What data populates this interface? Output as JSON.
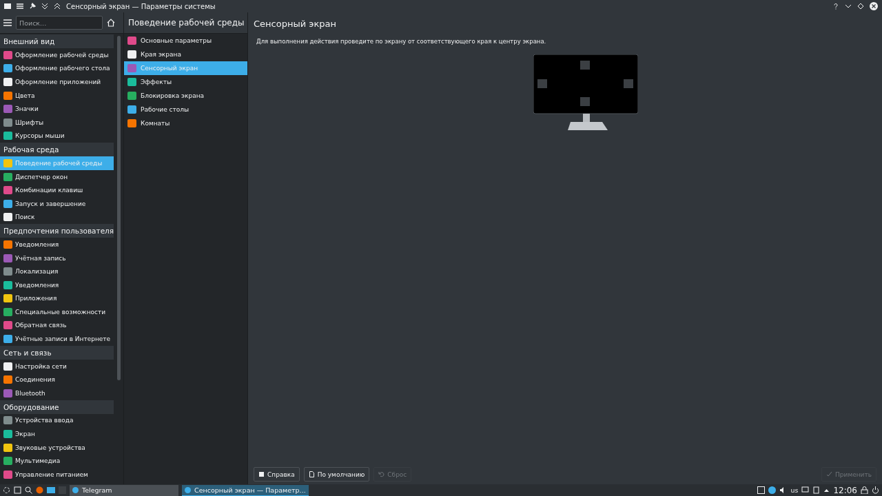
{
  "window": {
    "title": "Сенсорный экран — Параметры системы"
  },
  "sidebar": {
    "search": {
      "placeholder": "Поиск..."
    },
    "sections": [
      {
        "title": "Внешний вид",
        "items": [
          {
            "label": "Оформление рабочей среды",
            "selected": false
          },
          {
            "label": "Оформление рабочего стола",
            "selected": false
          },
          {
            "label": "Оформление приложений",
            "selected": false
          },
          {
            "label": "Цвета",
            "selected": false
          },
          {
            "label": "Значки",
            "selected": false
          },
          {
            "label": "Шрифты",
            "selected": false
          },
          {
            "label": "Курсоры мыши",
            "selected": false
          }
        ]
      },
      {
        "title": "Рабочая среда",
        "items": [
          {
            "label": "Поведение рабочей среды",
            "selected": true
          },
          {
            "label": "Диспетчер окон",
            "selected": false
          },
          {
            "label": "Комбинации клавиш",
            "selected": false
          },
          {
            "label": "Запуск и завершение",
            "selected": false
          },
          {
            "label": "Поиск",
            "selected": false
          }
        ]
      },
      {
        "title": "Предпочтения пользователя",
        "items": [
          {
            "label": "Уведомления",
            "selected": false
          },
          {
            "label": "Учётная запись",
            "selected": false
          },
          {
            "label": "Локализация",
            "selected": false
          },
          {
            "label": "Уведомления",
            "selected": false
          },
          {
            "label": "Приложения",
            "selected": false
          },
          {
            "label": "Специальные возможности",
            "selected": false
          },
          {
            "label": "Обратная связь",
            "selected": false
          },
          {
            "label": "Учётные записи в Интернете",
            "selected": false
          }
        ]
      },
      {
        "title": "Сеть и связь",
        "items": [
          {
            "label": "Настройка сети",
            "selected": false
          },
          {
            "label": "Соединения",
            "selected": false
          },
          {
            "label": "Bluetooth",
            "selected": false
          }
        ]
      },
      {
        "title": "Оборудование",
        "items": [
          {
            "label": "Устройства ввода",
            "selected": false
          },
          {
            "label": "Экран",
            "selected": false
          },
          {
            "label": "Звуковые устройства",
            "selected": false
          },
          {
            "label": "Мультимедиа",
            "selected": false
          },
          {
            "label": "Управление питанием",
            "selected": false
          }
        ]
      }
    ]
  },
  "subpanel": {
    "title": "Поведение рабочей среды",
    "items": [
      {
        "label": "Основные параметры",
        "selected": false
      },
      {
        "label": "Края экрана",
        "selected": false
      },
      {
        "label": "Сенсорный экран",
        "selected": true
      },
      {
        "label": "Эффекты",
        "selected": false
      },
      {
        "label": "Блокировка экрана",
        "selected": false
      },
      {
        "label": "Рабочие столы",
        "selected": false
      },
      {
        "label": "Комнаты",
        "selected": false
      }
    ]
  },
  "content": {
    "title": "Сенсорный экран",
    "description": "Для выполнения действия проведите по экрану от соответствующего края к центру экрана."
  },
  "buttons": [
    {
      "label": "Справка",
      "disabled": false
    },
    {
      "label": "По умолчанию",
      "disabled": false
    },
    {
      "label": "Сброс",
      "disabled": true
    },
    {
      "label": "Применить",
      "disabled": true
    }
  ],
  "taskbar": {
    "tasks": [
      {
        "label": "Telegram",
        "selected": false
      },
      {
        "label": "Сенсорный экран  — Параметр...",
        "selected": true
      }
    ],
    "keyboard_layout": "us",
    "clock": "12:06"
  }
}
